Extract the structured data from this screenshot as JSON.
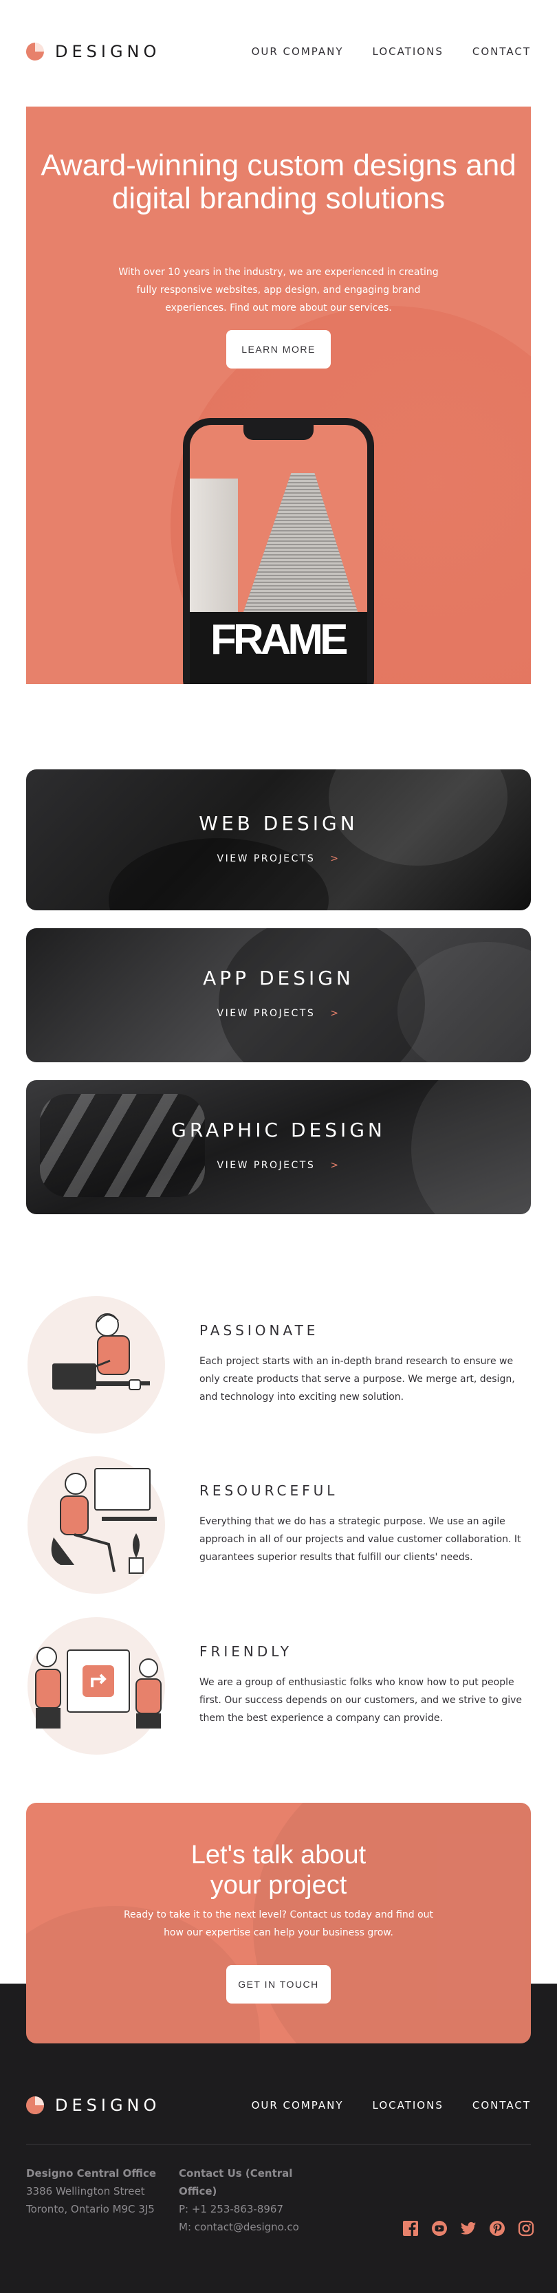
{
  "brand": {
    "name": "DESIGNO",
    "accent": "#e7816b",
    "dark": "#1d1c1e"
  },
  "nav": {
    "items": [
      "OUR COMPANY",
      "LOCATIONS",
      "CONTACT"
    ]
  },
  "hero": {
    "title": "Award-winning custom designs and digital branding solutions",
    "text": "With over 10 years in the industry, we are experienced in creating fully responsive websites, app design, and engaging brand experiences. Find out more about our services.",
    "button": "LEARN MORE",
    "phone_word": "FRAME"
  },
  "projects": [
    {
      "title": "WEB DESIGN",
      "link": "VIEW PROJECTS",
      "chevron": ">"
    },
    {
      "title": "APP DESIGN",
      "link": "VIEW PROJECTS",
      "chevron": ">"
    },
    {
      "title": "GRAPHIC DESIGN",
      "link": "VIEW PROJECTS",
      "chevron": ">"
    }
  ],
  "values": [
    {
      "title": "PASSIONATE",
      "text": "Each project starts with an in-depth brand research to ensure we only create products that serve a purpose. We merge art, design, and technology into exciting new solution."
    },
    {
      "title": "RESOURCEFUL",
      "text": "Everything that we do has a strategic purpose. We use an agile approach in all of our projects and value customer collaboration. It guarantees superior results that fulfill our clients' needs."
    },
    {
      "title": "FRIENDLY",
      "text": "We are a group of enthusiastic folks who know how to put people first. Our success depends on our customers, and we strive to give them the best experience a company can provide."
    }
  ],
  "cta": {
    "title": "Let's talk about your project",
    "text": "Ready to take it to the next level? Contact us today and find out how our expertise can help your business grow.",
    "button": "GET IN TOUCH"
  },
  "footer": {
    "office": {
      "head": "Designo Central Office",
      "line1": "3386 Wellington Street",
      "line2": "Toronto, Ontario M9C 3J5"
    },
    "contact": {
      "head": "Contact Us (Central Office)",
      "phone": "P: +1 253-863-8967",
      "email": "M: contact@designo.co"
    },
    "social": [
      "facebook-icon",
      "youtube-icon",
      "twitter-icon",
      "pinterest-icon",
      "instagram-icon"
    ]
  }
}
